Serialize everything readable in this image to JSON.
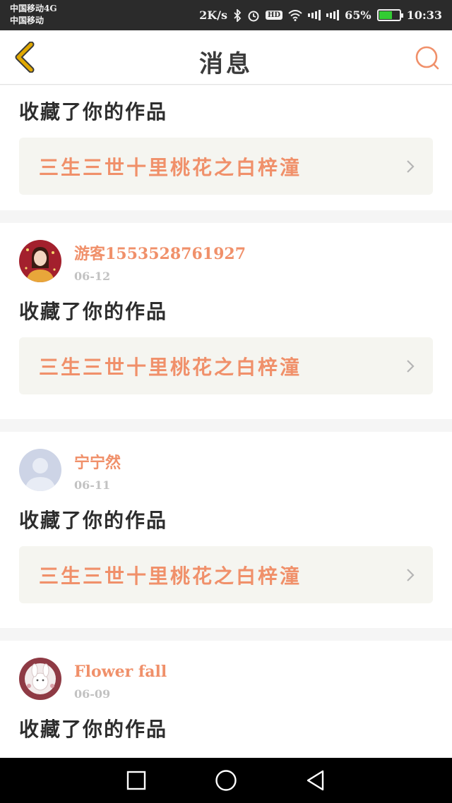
{
  "status_bar": {
    "carrier_line1": "中国移动4G",
    "carrier_line2": "中国移动",
    "speed": "2K/s",
    "hd": "HD",
    "battery_pct": "65%",
    "battery_level": 0.65,
    "time": "10:33"
  },
  "header": {
    "title": "消息",
    "icons": {
      "back": "chevron-left-icon",
      "search": "search-icon"
    }
  },
  "messages": [
    {
      "action": "收藏了你的作品",
      "work_title": "三生三世十里桃花之白梓潼"
    },
    {
      "username": "游客1553528761927",
      "date": "06-12",
      "action": "收藏了你的作品",
      "work_title": "三生三世十里桃花之白梓潼"
    },
    {
      "username": "宁宁然",
      "date": "06-11",
      "action": "收藏了你的作品",
      "work_title": "三生三世十里桃花之白梓潼"
    },
    {
      "username": "Flower fall",
      "date": "06-09",
      "action": "收藏了你的作品"
    }
  ],
  "colors": {
    "accent": "#f0906a",
    "text_dark": "#2d2d2d",
    "date_gray": "#c2c2c2",
    "back_icon": "#e0a800"
  },
  "nav_bar": {
    "icons": [
      "square-recent-apps-icon",
      "circle-home-icon",
      "triangle-back-icon"
    ]
  }
}
